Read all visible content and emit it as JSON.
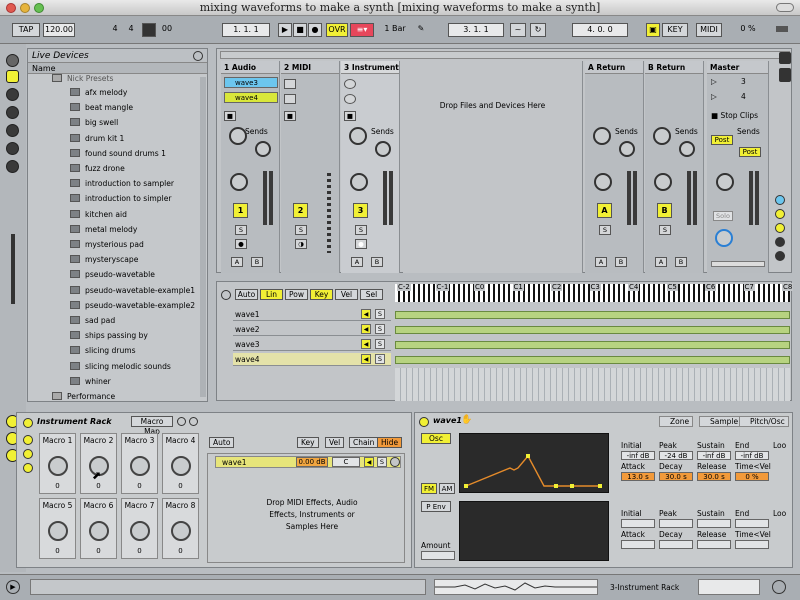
{
  "window": {
    "title": "mixing waveforms to make a synth  [mixing waveforms to make a synth]"
  },
  "transport": {
    "tap": "TAP",
    "tempo": "120.00",
    "sig_num": "4",
    "sig_den": "4",
    "metro": "00",
    "pos": "1.  1.  1",
    "ovr": "OVR",
    "quant": "1 Bar",
    "loop_start": "3.  1.  1",
    "loop_len": "4.  0.  0",
    "key": "KEY",
    "midi": "MIDI",
    "cpu": "0 %"
  },
  "browser": {
    "title": "Live Devices",
    "col": "Name",
    "parent": "Nick Presets",
    "items": [
      "afx melody",
      "beat mangle",
      "big swell",
      "drum kit 1",
      "found sound drums 1",
      "fuzz drone",
      "introduction to sampler",
      "introduction to simpler",
      "kitchen aid",
      "metal melody",
      "mysterious pad",
      "mysteryscape",
      "pseudo-wavetable",
      "pseudo-wavetable-example1",
      "pseudo-wavetable-example2",
      "sad pad",
      "ships passing by",
      "slicing drums",
      "slicing melodic sounds",
      "whiner"
    ],
    "footer": "Performance"
  },
  "session": {
    "tracks": [
      "1 Audio",
      "2 MIDI",
      "3 Instrument"
    ],
    "returns": [
      "A Return",
      "B Return"
    ],
    "master": "Master",
    "clips": [
      "wave3",
      "wave4"
    ],
    "master_scenes": [
      "3",
      "4"
    ],
    "drop_text": "Drop Files and Devices Here",
    "stop_clips": "Stop Clips",
    "sends": "Sends",
    "send_a": "A",
    "send_b": "B",
    "track_numbers": [
      "1",
      "2",
      "3"
    ],
    "return_letters": [
      "A",
      "B"
    ],
    "post": "Post",
    "solo": "Solo",
    "s": "S"
  },
  "arrangement": {
    "buttons": [
      "Auto",
      "Lin",
      "Pow",
      "Key",
      "Vel",
      "Sel"
    ],
    "ruler": [
      "C-2",
      "C-1",
      "C0",
      "C1",
      "C2",
      "C3",
      "C4",
      "C5",
      "C6",
      "C7",
      "C8"
    ],
    "rows": [
      "wave1",
      "wave2",
      "wave3",
      "wave4"
    ]
  },
  "rack": {
    "title": "Instrument Rack",
    "macro_map": "Macro Map",
    "macros": [
      {
        "name": "Macro 1",
        "value": "0"
      },
      {
        "name": "Macro 2",
        "value": "0"
      },
      {
        "name": "Macro 3",
        "value": "0"
      },
      {
        "name": "Macro 4",
        "value": "0"
      },
      {
        "name": "Macro 5",
        "value": "0"
      },
      {
        "name": "Macro 6",
        "value": "0"
      },
      {
        "name": "Macro 7",
        "value": "0"
      },
      {
        "name": "Macro 8",
        "value": "0"
      }
    ],
    "chain_buttons": [
      "Auto",
      "Key",
      "Vel",
      "Chain",
      "Hide"
    ],
    "chain": {
      "name": "wave1",
      "vol": "0.00 dB",
      "pan": "C",
      "s": "S"
    },
    "drop_text": "Drop MIDI Effects, Audio Effects, Instruments or Samples Here"
  },
  "sampler": {
    "title": "wave1",
    "tabs": [
      "Zone",
      "Sample",
      "Pitch/Osc"
    ],
    "osc": "Osc",
    "fm": "FM",
    "am": "AM",
    "penv": "P Env",
    "amount": "Amount",
    "env1": {
      "headers": [
        "Initial",
        "Peak",
        "Sustain",
        "End",
        "Loo"
      ],
      "values": [
        "-inf dB",
        "-24 dB",
        "-inf dB",
        "-inf dB"
      ],
      "h2": [
        "Attack",
        "Decay",
        "Release",
        "Time<Vel"
      ],
      "v2": [
        "13.0 s",
        "30.0 s",
        "30.0 s",
        "0 %"
      ]
    },
    "env2": {
      "headers": [
        "Initial",
        "Peak",
        "Sustain",
        "End",
        "Loo"
      ],
      "h2": [
        "Attack",
        "Decay",
        "Release",
        "Time<Vel"
      ]
    }
  },
  "status": {
    "track_label": "3-Instrument Rack"
  }
}
